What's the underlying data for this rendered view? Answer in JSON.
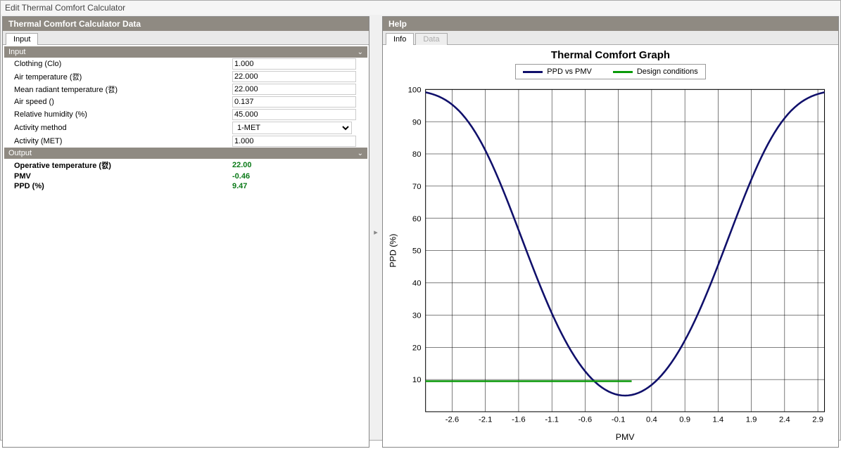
{
  "window_title": "Edit Thermal Comfort Calculator",
  "left_panel": {
    "header": "Thermal Comfort Calculator Data",
    "tab": "Input",
    "input_section": "Input",
    "output_section": "Output",
    "fields": {
      "clothing": {
        "label": "Clothing (Clo)",
        "value": "1.000"
      },
      "air_temp": {
        "label": "Air temperature (캜)",
        "value": "22.000"
      },
      "mrt": {
        "label": "Mean radiant temperature (캜)",
        "value": "22.000"
      },
      "air_speed": {
        "label": "Air speed ()",
        "value": "0.137"
      },
      "rh": {
        "label": "Relative humidity (%)",
        "value": "45.000"
      },
      "activity_method": {
        "label": "Activity method",
        "value": "1-MET"
      },
      "activity_met": {
        "label": "Activity (MET)",
        "value": "1.000"
      }
    },
    "outputs": {
      "op_temp": {
        "label": "Operative temperature (캜)",
        "value": "22.00"
      },
      "pmv": {
        "label": "PMV",
        "value": "-0.46"
      },
      "ppd": {
        "label": "PPD (%)",
        "value": "9.47"
      }
    }
  },
  "right_panel": {
    "header": "Help",
    "tabs": {
      "active": "Info",
      "inactive": "Data"
    },
    "chart_title": "Thermal Comfort Graph",
    "legend": {
      "ppd": "PPD vs PMV",
      "design": "Design conditions"
    },
    "xlabel": "PMV",
    "ylabel": "PPD (%)",
    "colors": {
      "ppd": "#10106b",
      "design": "#0a9a0a"
    }
  },
  "chart_data": {
    "type": "line",
    "title": "Thermal Comfort Graph",
    "xlabel": "PMV",
    "ylabel": "PPD (%)",
    "xlim": [
      -3,
      3
    ],
    "ylim": [
      0,
      100
    ],
    "xticks": [
      -2.6,
      -2.1,
      -1.6,
      -1.1,
      -0.6,
      -0.1,
      0.4,
      0.9,
      1.4,
      1.9,
      2.4,
      2.9
    ],
    "yticks": [
      10,
      20,
      30,
      40,
      50,
      60,
      70,
      80,
      90,
      100
    ],
    "series": [
      {
        "name": "PPD vs PMV",
        "color": "#10106b",
        "x": [
          -3,
          -2.5,
          -2,
          -1.5,
          -1,
          -0.5,
          0,
          0.5,
          1,
          1.5,
          2,
          2.5,
          3
        ],
        "y": [
          99,
          93.5,
          77,
          51,
          26,
          10,
          5,
          10,
          26,
          51,
          77,
          93.5,
          99
        ]
      },
      {
        "name": "Design conditions",
        "color": "#0a9a0a",
        "x": [
          -3,
          0.1
        ],
        "y": [
          9.47,
          9.47
        ]
      }
    ]
  }
}
